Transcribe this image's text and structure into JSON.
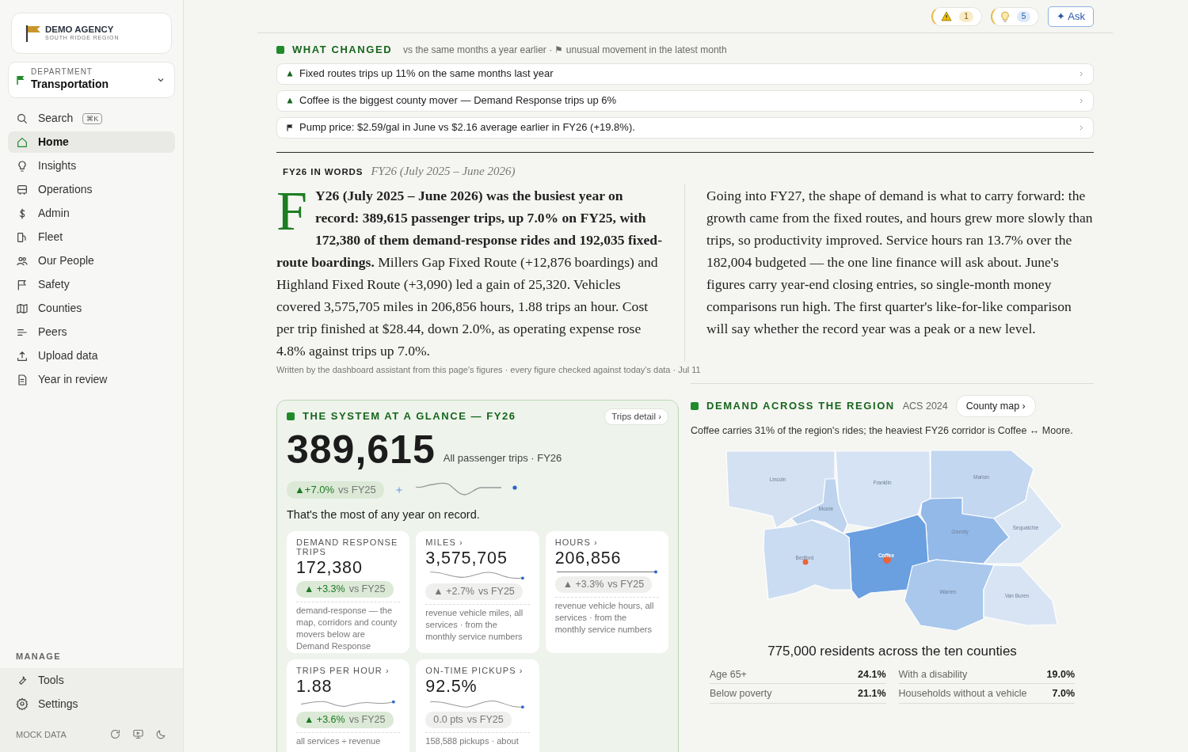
{
  "sidebar": {
    "logo": {
      "name": "DEMO AGENCY",
      "tagline": "SOUTH RIDGE REGION"
    },
    "department": {
      "label": "DEPARTMENT",
      "value": "Transportation"
    },
    "search": {
      "label": "Search",
      "shortcut": "⌘K"
    },
    "nav": [
      {
        "label": "Home",
        "selected": true
      },
      {
        "label": "Insights",
        "selected": false
      },
      {
        "label": "Operations",
        "selected": false
      },
      {
        "label": "Admin",
        "selected": false
      },
      {
        "label": "Fleet",
        "selected": false
      },
      {
        "label": "Our People",
        "selected": false
      },
      {
        "label": "Safety",
        "selected": false
      },
      {
        "label": "Counties",
        "selected": false
      },
      {
        "label": "Peers",
        "selected": false
      },
      {
        "label": "Upload data",
        "selected": false
      },
      {
        "label": "Year in review",
        "selected": false
      }
    ],
    "manage": {
      "heading": "MANAGE",
      "items": [
        {
          "label": "Tools",
          "selected": false
        },
        {
          "label": "Settings",
          "selected": false
        }
      ]
    },
    "footer": {
      "label": "MOCK DATA"
    }
  },
  "topbar": {
    "alerts": [
      {
        "kind": "warning",
        "count": "1"
      },
      {
        "kind": "idea",
        "count": "5"
      }
    ],
    "ask_button": "✦ Ask"
  },
  "what_changed": {
    "title": "WHAT CHANGED",
    "subtitle": "vs the same months a year earlier · ⚑ unusual movement in the latest month",
    "items": [
      {
        "kind": "up",
        "text": "Fixed routes trips up 11% on the same months last year"
      },
      {
        "kind": "up",
        "text": "Coffee is the biggest county mover — Demand Response trips up 6%"
      },
      {
        "kind": "flag",
        "text": "Pump price: $2.59/gal in June vs $2.16 average earlier in FY26 (+19.8%)."
      }
    ]
  },
  "in_words": {
    "heading": "FY26 IN WORDS",
    "period": "FY26 (July 2025 – June 2026)",
    "lead": "**FY26 (July 2025 – June 2026) was the busiest year on record: 389,615 passenger trips, up 7.0% on FY25, with 172,380 of them demand-response rides and 192,035 fixed-route boardings.** Millers Gap Fixed Route (+12,876 boardings) and Highland Fixed Route (+3,090) led a gain of 25,320. Vehicles covered 3,575,705 miles in 206,856 hours, 1.88 trips an hour. Cost per trip finished at $28.44, down 2.0%, as operating expense rose 4.8% against trips up 7.0%.",
    "second": "Going into FY27, the shape of demand is what to carry forward: the growth came from the fixed routes, and hours grew more slowly than trips, so productivity improved. Service hours ran 13.7% over the 182,004 budgeted — the one line finance will ask about. June's figures carry year-end closing entries, so single-month money comparisons run high. The first quarter's like-for-like comparison will say whether the record year was a peak or a new level.",
    "footnote": "Written by the dashboard assistant from this page's figures · every figure checked against today's data · Jul 11"
  },
  "glance": {
    "title": "THE SYSTEM AT A GLANCE — FY26",
    "detail_link": "Trips detail ›",
    "total": "389,615",
    "total_caption": "All passenger trips · FY26",
    "delta": {
      "value": "▲+7.0%",
      "versus": "vs FY25"
    },
    "remark": "That's the most of any year on record.",
    "metrics": [
      {
        "label": "DEMAND RESPONSE TRIPS",
        "value": "172,380",
        "trend": false,
        "delta": {
          "value": "▲ +3.3%",
          "versus": "vs FY25",
          "positive": true
        },
        "note": "demand-response — the map, corridors and county movers below are Demand Response"
      },
      {
        "label": "MILES ›",
        "value": "3,575,705",
        "trend": true,
        "delta": {
          "value": "▲ +2.7%",
          "versus": "vs FY25",
          "positive": false
        },
        "note": "revenue vehicle miles, all services · from the monthly service numbers"
      },
      {
        "label": "HOURS ›",
        "value": "206,856",
        "trend": true,
        "delta": {
          "value": "▲ +3.3%",
          "versus": "vs FY25",
          "positive": false
        },
        "note": "revenue vehicle hours, all services · from the monthly service numbers"
      },
      {
        "label": "TRIPS PER HOUR ›",
        "value": "1.88",
        "trend": true,
        "delta": {
          "value": "▲ +3.6%",
          "versus": "vs FY25",
          "positive": true
        },
        "note": "all services ÷ revenue"
      },
      {
        "label": "ON-TIME PICKUPS ›",
        "value": "92.5%",
        "trend": true,
        "delta": {
          "value": "0.0 pts",
          "versus": "vs FY25",
          "positive": false
        },
        "note": "158,588 pickups · about"
      }
    ]
  },
  "demand": {
    "title": "DEMAND ACROSS THE REGION",
    "source": "ACS 2024",
    "map_link": "County map ›",
    "summary": "Coffee carries 31% of the region's rides; the heaviest FY26 corridor is Coffee ↔ Moore.",
    "map": {
      "counties": [
        {
          "name": "Lincoln",
          "color": "#d3e1f3",
          "marker": false
        },
        {
          "name": "Franklin",
          "color": "#d5e3f4",
          "marker": false
        },
        {
          "name": "Marion",
          "color": "#c3d7f0",
          "marker": false
        },
        {
          "name": "Moore",
          "color": "#bdd3ee",
          "marker": false
        },
        {
          "name": "Sequatchie",
          "color": "#dae6f4",
          "marker": false
        },
        {
          "name": "Grundy",
          "color": "#93b9e8",
          "marker": false
        },
        {
          "name": "Coffee",
          "color": "#6a9fe0",
          "marker": true
        },
        {
          "name": "Bedford",
          "color": "#cadcf2",
          "marker": true
        },
        {
          "name": "Warren",
          "color": "#a9c8ec",
          "marker": false
        },
        {
          "name": "Van Buren",
          "color": "#d8e4f4",
          "marker": false
        }
      ]
    },
    "population": "775,000 residents across the ten counties",
    "stats": [
      {
        "label": "Age 65+",
        "value": "24.1%"
      },
      {
        "label": "With a disability",
        "value": "19.0%"
      },
      {
        "label": "Below poverty",
        "value": "21.1%"
      },
      {
        "label": "Households without a vehicle",
        "value": "7.0%"
      }
    ]
  }
}
